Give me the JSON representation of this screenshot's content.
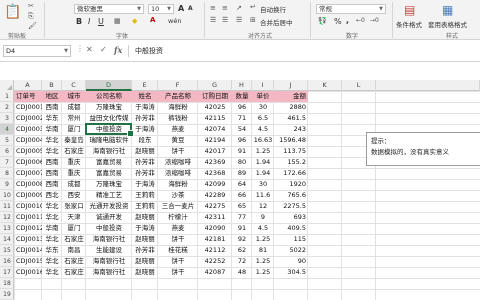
{
  "ribbon": {
    "clipboard": {
      "paste_icon": "paste-icon",
      "cut_icon": "scissors-icon",
      "copy_icon": "copy-icon",
      "format_painter_icon": "format-painter-icon",
      "group_label": "剪贴板"
    },
    "font": {
      "name": "微软雅黑",
      "size": "10",
      "bold": "B",
      "italic": "I",
      "underline": "U",
      "grow": "A",
      "shrink": "A",
      "wen": "wén",
      "group_label": "字体"
    },
    "alignment": {
      "wrap_text": "自动换行",
      "merge_center": "合并后居中",
      "group_label": "对齐方式"
    },
    "number": {
      "format": "常规",
      "currency": "%",
      "comma": ",",
      "group_label": "数字"
    },
    "styles": {
      "conditional": "条件格式",
      "table_format": "套用表格格式",
      "group_label": "样式"
    }
  },
  "formula_bar": {
    "name_box": "D4",
    "cancel_icon": "cancel-icon",
    "confirm_icon": "check-icon",
    "fx": "fx",
    "content": "中般投资"
  },
  "columns": [
    "A",
    "B",
    "C",
    "D",
    "E",
    "F",
    "G",
    "H",
    "I",
    "J",
    "K",
    "L"
  ],
  "selected": {
    "column": "D",
    "row": 4
  },
  "header_row": [
    "订单号",
    "地区",
    "城市",
    "公司名称",
    "姓名",
    "产品名称",
    "订购日期",
    "数量",
    "单价",
    "金额"
  ],
  "rows": [
    [
      "CDJ0001",
      "西南",
      "成都",
      "万隆珠宝",
      "于海涛",
      "海鲜粉",
      "42025",
      "96",
      "30",
      "2880"
    ],
    [
      "CDJ0002",
      "华东",
      "常州",
      "益田文化传媒",
      "孙芳菲",
      "裤钱粉",
      "42115",
      "71",
      "6.5",
      "461.5"
    ],
    [
      "CDJ0003",
      "华南",
      "厦门",
      "中般投资",
      "于海涛",
      "燕麦",
      "42074",
      "54",
      "4.5",
      "243"
    ],
    [
      "CDJ0004",
      "华北",
      "秦皇岛",
      "瑞隆电脑软件",
      "段东",
      "黄豆",
      "42194",
      "96",
      "16.63",
      "1596.48"
    ],
    [
      "CDJ0005",
      "华北",
      "石家庄",
      "海南银行社",
      "赵晓丽",
      "饼干",
      "42017",
      "91",
      "1.25",
      "113.75"
    ],
    [
      "CDJ0006",
      "西南",
      "重庆",
      "富嘉贸易",
      "孙芳菲",
      "浓缩咖啡",
      "42369",
      "80",
      "1.94",
      "155.2"
    ],
    [
      "CDJ0007",
      "西南",
      "重庆",
      "富嘉贸易",
      "孙芳菲",
      "浓缩咖啡",
      "42368",
      "89",
      "1.94",
      "172.66"
    ],
    [
      "CDJ0008",
      "西南",
      "成都",
      "万隆珠宝",
      "于海涛",
      "海鲜粉",
      "42099",
      "64",
      "30",
      "1920"
    ],
    [
      "CDJ0009",
      "西北",
      "西安",
      "精准工艺",
      "王莉莉",
      "沙茶",
      "42289",
      "66",
      "11.6",
      "765.6"
    ],
    [
      "CDJ0010",
      "华北",
      "张家口",
      "光通开发投资",
      "王莉莉",
      "三合一麦片",
      "42275",
      "65",
      "12",
      "2275.5"
    ],
    [
      "CDJ0011",
      "华北",
      "天津",
      "诚通开发",
      "赵晓丽",
      "柠檬汁",
      "42311",
      "77",
      "9",
      "693"
    ],
    [
      "CDJ0012",
      "华南",
      "厦门",
      "中般投资",
      "于海涛",
      "燕麦",
      "42090",
      "91",
      "4.5",
      "409.5"
    ],
    [
      "CDJ0013",
      "华北",
      "石家庄",
      "海南银行社",
      "赵晓丽",
      "饼干",
      "42181",
      "92",
      "1.25",
      "115"
    ],
    [
      "CDJ0014",
      "华东",
      "南昌",
      "生能建设",
      "孙芳菲",
      "桂花糕",
      "42112",
      "62",
      "81",
      "5022"
    ],
    [
      "CDJ0015",
      "华北",
      "石家庄",
      "海南银行社",
      "赵晓丽",
      "饼干",
      "42252",
      "72",
      "1.25",
      "90"
    ],
    [
      "CDJ0016",
      "华北",
      "石家庄",
      "海南银行社",
      "赵晓丽",
      "饼干",
      "42087",
      "48",
      "1.25",
      "304.5"
    ]
  ],
  "note": {
    "title": "提示：",
    "body": "数据模拟的，没有真实意义"
  }
}
